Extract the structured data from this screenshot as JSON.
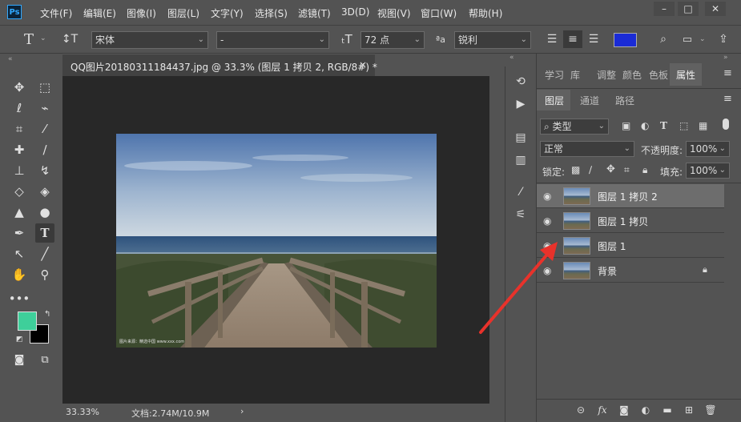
{
  "menu": {
    "logo": "Ps",
    "items": [
      "文件(F)",
      "编辑(E)",
      "图像(I)",
      "图层(L)",
      "文字(Y)",
      "选择(S)",
      "滤镜(T)",
      "3D(D)",
      "视图(V)",
      "窗口(W)",
      "帮助(H)"
    ]
  },
  "options": {
    "tool_icon": "T",
    "font_family": "宋体",
    "font_style": "-",
    "font_size": "72 点",
    "aa_label": "ªa",
    "antialias": "锐利",
    "color_swatch": "#1a2bd6"
  },
  "document": {
    "tab_title": "QQ图片20180311184437.jpg @ 33.3% (图层 1 拷贝 2, RGB/8#) *",
    "close": "×",
    "watermark": "图片来源：精选中国 www.xxx.com"
  },
  "status": {
    "zoom": "33.33%",
    "doc_size": "文档:2.74M/10.9M",
    "arrow": "›"
  },
  "colors": {
    "foreground": "#3ecf9a",
    "background": "#000000"
  },
  "panel": {
    "top_tabs": [
      "学习",
      "库",
      "调整",
      "颜色",
      "色板",
      "属性"
    ],
    "sub_tabs": [
      "图层",
      "通道",
      "路径"
    ],
    "filter_label": "类型",
    "blend_mode": "正常",
    "opacity_label": "不透明度:",
    "opacity_value": "100%",
    "lock_label": "锁定:",
    "fill_label": "填充:",
    "fill_value": "100%",
    "layers": [
      {
        "name": "图层 1 拷贝 2",
        "selected": true,
        "locked": false
      },
      {
        "name": "图层 1 拷贝",
        "selected": false,
        "locked": false
      },
      {
        "name": "图层 1",
        "selected": false,
        "locked": false
      },
      {
        "name": "背景",
        "selected": false,
        "locked": true
      }
    ],
    "bottom_icons": [
      "link-icon",
      "fx-icon",
      "mask-icon",
      "adjustment-icon",
      "group-icon",
      "new-layer-icon",
      "trash-icon"
    ],
    "fx_label": "fx"
  }
}
